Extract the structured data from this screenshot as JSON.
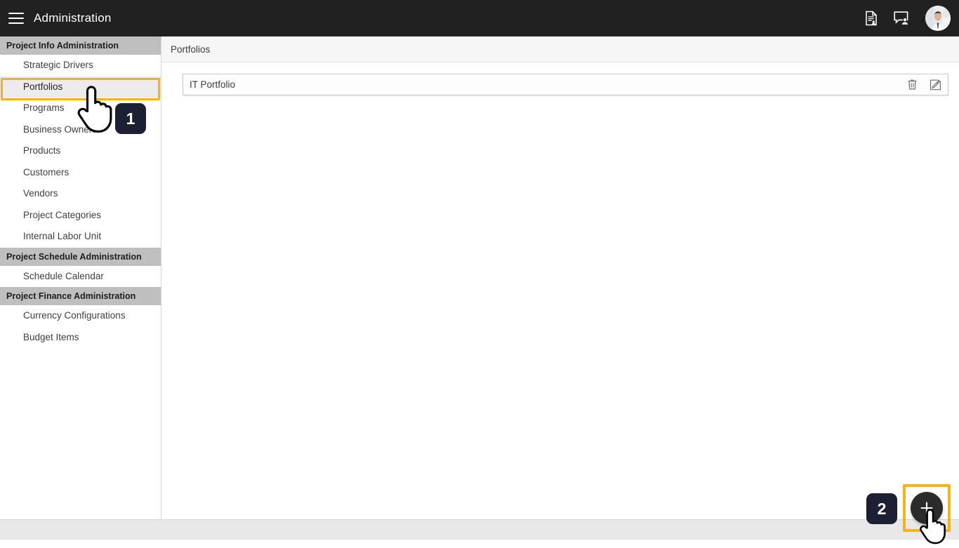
{
  "topbar": {
    "menu_icon": "hamburger-menu-icon",
    "title": "Administration",
    "icons": [
      {
        "name": "document-user-icon",
        "label": "Document User"
      },
      {
        "name": "chat-user-icon",
        "label": "Chat User"
      }
    ],
    "avatar_name": "user-avatar",
    "background_color": "#212121"
  },
  "sidebar": {
    "groups": [
      {
        "header": "Project Info Administration",
        "items": [
          {
            "label": "Strategic Drivers",
            "selected": false
          },
          {
            "label": "Portfolios",
            "selected": true
          },
          {
            "label": "Programs",
            "selected": false
          },
          {
            "label": "Business Owners",
            "selected": false
          },
          {
            "label": "Products",
            "selected": false
          },
          {
            "label": "Customers",
            "selected": false
          },
          {
            "label": "Vendors",
            "selected": false
          },
          {
            "label": "Project Categories",
            "selected": false
          },
          {
            "label": "Internal Labor Unit",
            "selected": false
          }
        ]
      },
      {
        "header": "Project Schedule Administration",
        "items": [
          {
            "label": "Schedule Calendar",
            "selected": false
          }
        ]
      },
      {
        "header": "Project Finance Administration",
        "items": [
          {
            "label": "Currency Configurations",
            "selected": false
          },
          {
            "label": "Budget Items",
            "selected": false
          }
        ]
      }
    ]
  },
  "content": {
    "breadcrumb": "Portfolios",
    "rows": [
      {
        "label": "IT Portfolio",
        "actions": [
          {
            "name": "delete-icon",
            "label": "Delete"
          },
          {
            "name": "edit-icon",
            "label": "Edit"
          }
        ]
      }
    ],
    "fab": {
      "name": "add-portfolio-button",
      "glyph": "+"
    }
  },
  "annotations": {
    "highlight_color": "#f5b316",
    "steps": [
      {
        "number": "1",
        "target": "sidebar-item-portfolios"
      },
      {
        "number": "2",
        "target": "add-portfolio-button"
      }
    ]
  }
}
